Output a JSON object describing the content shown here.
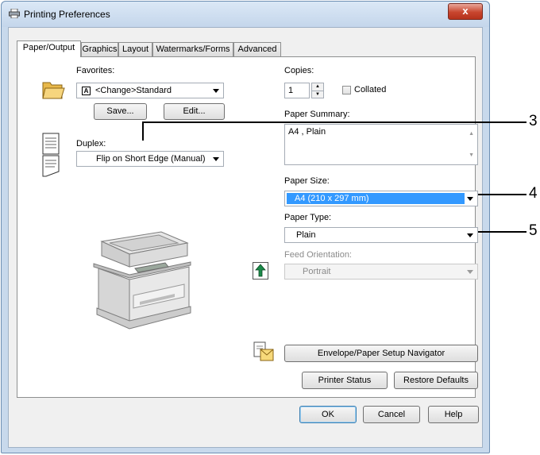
{
  "window": {
    "title": "Printing Preferences",
    "close_label": "x"
  },
  "tabs": [
    "Paper/Output",
    "Graphics",
    "Layout",
    "Watermarks/Forms",
    "Advanced"
  ],
  "favorites": {
    "label": "Favorites:",
    "value": "<Change>Standard",
    "save_label": "Save...",
    "edit_label": "Edit..."
  },
  "duplex": {
    "label": "Duplex:",
    "value": "Flip on Short Edge (Manual)"
  },
  "copies": {
    "label": "Copies:",
    "value": "1",
    "collated_label": "Collated"
  },
  "paper_summary": {
    "label": "Paper Summary:",
    "value": "A4 , Plain"
  },
  "paper_size": {
    "label": "Paper Size:",
    "value": "A4 (210 x 297 mm)"
  },
  "paper_type": {
    "label": "Paper Type:",
    "value": "Plain"
  },
  "feed_orientation": {
    "label": "Feed Orientation:",
    "value": "Portrait"
  },
  "buttons": {
    "envelope_navigator": "Envelope/Paper Setup Navigator",
    "printer_status": "Printer Status",
    "restore_defaults": "Restore Defaults",
    "ok": "OK",
    "cancel": "Cancel",
    "help": "Help"
  },
  "callouts": [
    "3",
    "4",
    "5"
  ]
}
